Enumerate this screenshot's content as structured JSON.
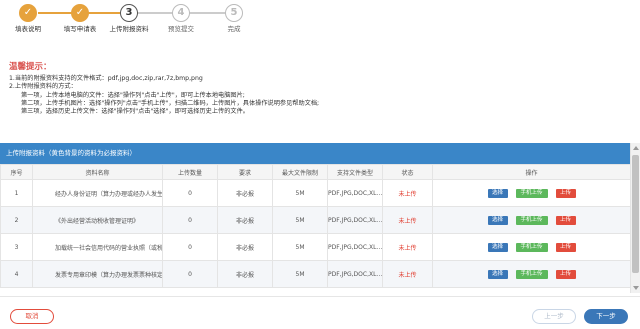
{
  "colors": {
    "step_done": "#e6a23c",
    "section_bar": "#3a86c8",
    "status_red": "#e0392b",
    "btn_select": "#3a77b8",
    "btn_phone": "#5cb85c",
    "btn_upload": "#e24c3c"
  },
  "steps": [
    {
      "number": "✓",
      "label": "填表说明",
      "state": "done",
      "icon": "check-icon"
    },
    {
      "number": "✓",
      "label": "填写申请表",
      "state": "done",
      "icon": "check-icon"
    },
    {
      "number": "3",
      "label": "上传附报资料",
      "state": "active",
      "icon": ""
    },
    {
      "number": "4",
      "label": "预览提交",
      "state": "todo",
      "icon": ""
    },
    {
      "number": "5",
      "label": "完成",
      "state": "todo",
      "icon": ""
    }
  ],
  "tips": {
    "title": "温馨提示：",
    "line1": "1.当前的附报资料支持的文件格式：pdf,jpg,doc,zip,rar,7z,bmp,png",
    "line2": "2.上传附报资料的方式：",
    "sub1": "第一项，上传本地电脑的文件：选择\"操作列\"点击\"上传\"，即可上传本地电脑图片;",
    "sub2": "第二项，上传手机图片：选择\"操作列\"点击\"手机上传\"，扫描二维码，上传图片，具体操作说明参见帮助文档;",
    "sub3": "第三项，选择历史上传文件：选择\"操作列\"点击\"选择\"，即可选择历史上传的文件。"
  },
  "section": {
    "title": "上传附报资料",
    "note": "（黄色背景的资料为必报资料）"
  },
  "table": {
    "headers": {
      "seq": "序号",
      "name": "资料名称",
      "count": "上传数量",
      "req": "要求",
      "maxsize": "最大文件限制",
      "types": "支持文件类型",
      "status": "状态",
      "ops": "操作"
    },
    "rows": [
      {
        "seq": "1",
        "name": "经办人身份证明（算力办理或经办人发生变化时提",
        "count": "0",
        "req": "非必报",
        "maxsize": "5M",
        "types": "PDF,JPG,DOC,XL…",
        "status": "未上传"
      },
      {
        "seq": "2",
        "name": "《外出经营活动税收管理证明》",
        "count": "0",
        "req": "非必报",
        "maxsize": "5M",
        "types": "PDF,JPG,DOC,XL…",
        "status": "未上传"
      },
      {
        "seq": "3",
        "name": "加载统一社会信用代码的营业执照（或税务登记证",
        "count": "0",
        "req": "非必报",
        "maxsize": "5M",
        "types": "PDF,JPG,DOC,XL…",
        "status": "未上传"
      },
      {
        "seq": "4",
        "name": "发票专用章印模（算力办理发票票种核定时提供）",
        "count": "0",
        "req": "非必报",
        "maxsize": "5M",
        "types": "PDF,JPG,DOC,XL…",
        "status": "未上传"
      }
    ],
    "ops": {
      "select": "选择",
      "phone": "手机上传",
      "upload": "上传"
    }
  },
  "footer": {
    "cancel": "取消",
    "prev": "上一步",
    "next": "下一步"
  }
}
